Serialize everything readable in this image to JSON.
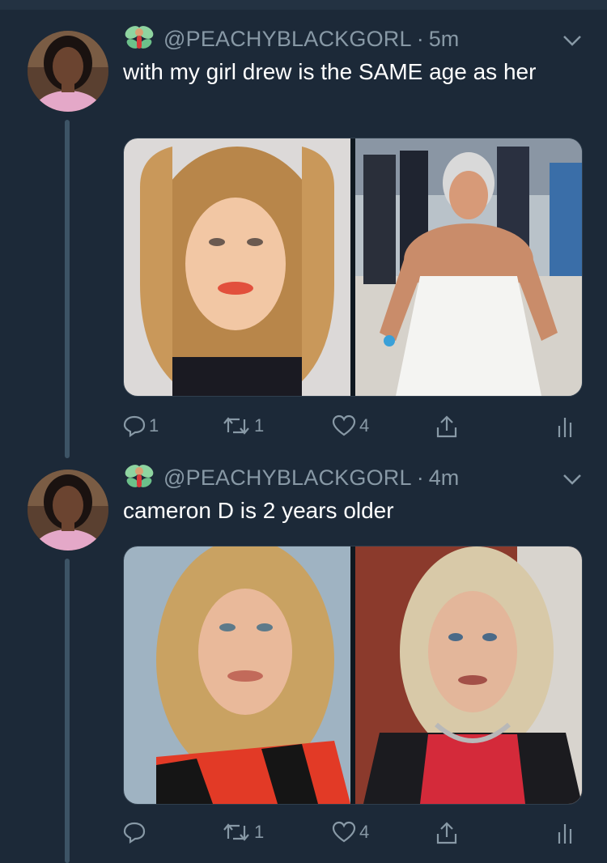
{
  "tweets": [
    {
      "handle": "@PEACHYBLACKGORL",
      "separator": "·",
      "time": "5m",
      "text": "with my girl drew is the SAME age as her",
      "actions": {
        "reply_count": "1",
        "retweet_count": "1",
        "like_count": "4"
      }
    },
    {
      "handle": "@PEACHYBLACKGORL",
      "separator": "·",
      "time": "4m",
      "text": "cameron D is 2 years older",
      "actions": {
        "reply_count": "",
        "retweet_count": "1",
        "like_count": "4"
      }
    }
  ],
  "icons": {
    "display_name_emoji": "fairy-icon",
    "reply": "reply-icon",
    "retweet": "retweet-icon",
    "like": "heart-icon",
    "share": "share-icon",
    "analytics": "analytics-icon",
    "menu": "chevron-down-icon"
  },
  "colors": {
    "background": "#1c2938",
    "secondary_text": "#8899a6",
    "thread_line": "#3d5466"
  }
}
